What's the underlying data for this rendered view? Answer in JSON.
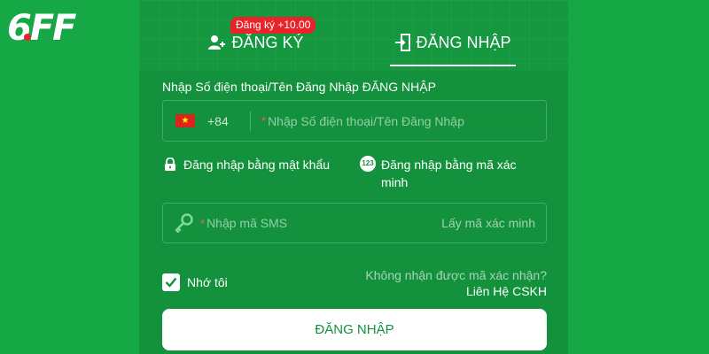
{
  "brand": {
    "logo_text": "6FF"
  },
  "tabs": {
    "register_label": "ĐĂNG KÝ",
    "register_badge": "Đăng ký +10.00",
    "login_label": "ĐĂNG NHẬP"
  },
  "form": {
    "field_label": "Nhập Số điện thoại/Tên Đăng Nhập ĐĂNG NHẬP",
    "country_code": "+84",
    "phone_placeholder": "Nhập Số điện thoại/Tên Đăng Nhập",
    "required_mark": "*",
    "login_with_password": "Đăng nhập bằng mật khẩu",
    "login_with_code": "Đăng nhập bằng mã xác minh",
    "code_icon_text": "123",
    "sms_placeholder": "Nhập mã SMS",
    "get_code_label": "Lấy mã xác minh",
    "remember_label": "Nhớ tôi",
    "remember_checked": true,
    "no_code_question": "Không nhận được mã xác nhận?",
    "contact_support": "Liên Hệ CSKH",
    "submit_label": "ĐĂNG NHẬP"
  },
  "colors": {
    "background": "#17a846",
    "panel": "#13913c",
    "badge": "#e8232a",
    "required": "#ff5a5a"
  }
}
